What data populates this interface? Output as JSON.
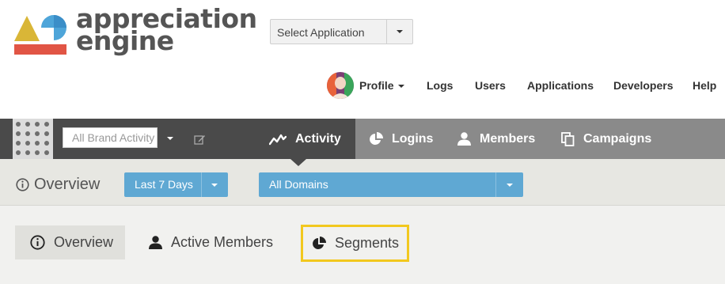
{
  "brand": {
    "logo_line1": "appreciation",
    "logo_line2": "engine",
    "colors": {
      "yellow": "#d9b637",
      "blue": "#4ea5d9",
      "red": "#e15545",
      "text": "#555555"
    }
  },
  "app_select": {
    "label": "Select Application"
  },
  "top_nav": {
    "profile": "Profile",
    "items": [
      "Logs",
      "Users",
      "Applications",
      "Developers",
      "Help"
    ]
  },
  "toolbar": {
    "brand_input_value": "All Brand Activity",
    "tabs": [
      {
        "label": "Activity",
        "icon": "activity-icon",
        "active": true
      },
      {
        "label": "Logins",
        "icon": "pie-chart-icon",
        "active": false
      },
      {
        "label": "Members",
        "icon": "user-icon",
        "active": false
      },
      {
        "label": "Campaigns",
        "icon": "copy-icon",
        "active": false
      }
    ]
  },
  "filter_bar": {
    "title": "Overview",
    "date_range": "Last 7 Days",
    "domains": "All Domains"
  },
  "sub_tabs": [
    {
      "label": "Overview",
      "icon": "info-icon",
      "active": true
    },
    {
      "label": "Active Members",
      "icon": "user-icon",
      "active": false
    },
    {
      "label": "Segments",
      "icon": "pie-chart-icon",
      "active": false,
      "highlighted": true
    }
  ],
  "colors": {
    "dark_bar": "#4a4a4a",
    "tab_bar": "#8a8a8a",
    "accent_blue": "#5fa8d3",
    "highlight": "#f2c81e"
  }
}
